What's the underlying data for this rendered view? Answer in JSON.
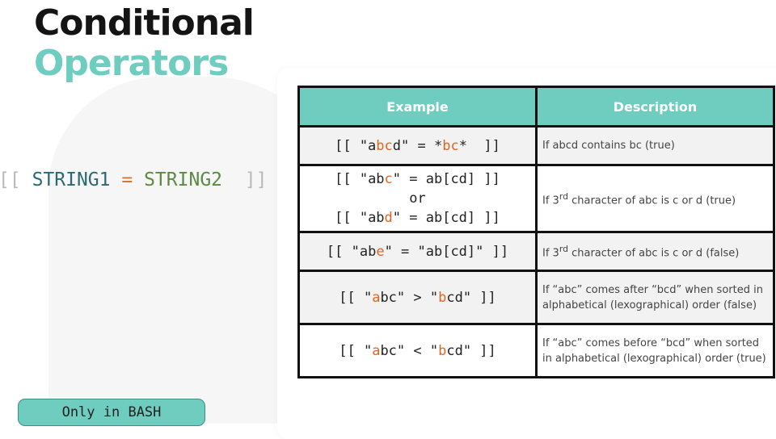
{
  "title": {
    "line1": "Conditional",
    "line2": "Operators"
  },
  "syntax": {
    "open": "[[",
    "left": "STRING1",
    "eq": "=",
    "right": "STRING2",
    "close": "]]"
  },
  "bash_label": "Only in BASH",
  "table": {
    "headers": [
      "Example",
      "Description"
    ],
    "rows": [
      {
        "ex": {
          "a": "[[ \"a",
          "b": "bc",
          "c": "d\" = *",
          "d": "bc",
          "e": "*  ]]"
        },
        "desc": "If abcd contains bc (true)"
      },
      {
        "ex": {
          "l1a": "[[ \"ab",
          "l1b": "c",
          "l1c": "\" = ab[cd] ]]",
          "l2": "or",
          "l3a": "[[ \"ab",
          "l3b": "d",
          "l3c": "\" = ab[cd] ]]"
        },
        "desc": {
          "pre": "If 3",
          "sup": "rd",
          "post": " character of abc is c or d (true)"
        }
      },
      {
        "ex": {
          "a": "[[ \"ab",
          "b": "e",
          "c": "\" = \"ab[cd]\" ]]"
        },
        "desc": {
          "pre": "If 3",
          "sup": "rd",
          "post": " character of abc is c or d (false)"
        }
      },
      {
        "ex": {
          "a": "[[ \"",
          "b": "a",
          "c": "bc\" > \"",
          "d": "b",
          "e": "cd\" ]]"
        },
        "desc": "If “abc” comes after “bcd” when sorted in alphabetical (lexographical) order (false)"
      },
      {
        "ex": {
          "a": "[[ \"",
          "b": "a",
          "c": "bc\" < \"",
          "d": "b",
          "e": "cd\" ]]"
        },
        "desc": "If “abc” comes before “bcd” when sorted in alphabetical (lexographical) order (true)"
      }
    ]
  },
  "colors": {
    "accent": "#6ecdbf",
    "highlight": "#e4641f",
    "title": "#141414"
  }
}
